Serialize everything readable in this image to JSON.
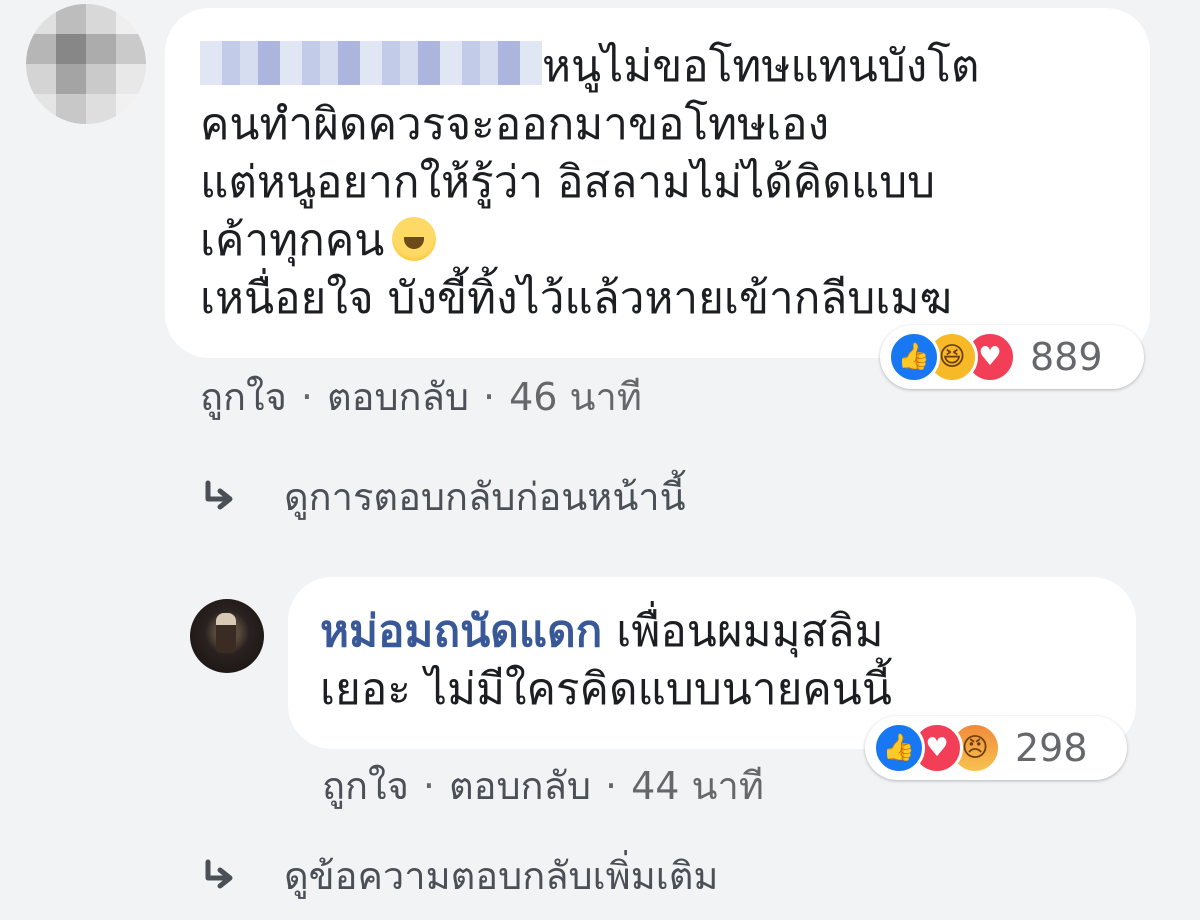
{
  "comment1": {
    "author": "",
    "lines": [
      "หนูไม่ขอโทษแทนบังโต",
      "คนทำผิดควรจะออกมาขอโทษเอง",
      "แต่หนูอยากให้รู้ว่า อิสลามไม่ได้คิดแบบ",
      "เค้าทุกคน",
      "เหนื่อยใจ บังขี้ทิ้งไว้แล้วหายเข้ากลีบเมฆ"
    ],
    "inline_emoji": "crying-face-emoji",
    "reactions": {
      "icons": [
        "like",
        "haha",
        "love"
      ],
      "count": "889"
    },
    "meta": {
      "like": "ถูกใจ",
      "reply": "ตอบกลับ",
      "separator": "·",
      "time": "46 นาที"
    }
  },
  "previous_replies_link": "ดูการตอบกลับก่อนหน้านี้",
  "comment2": {
    "author": "หม่อมถนัดแดก",
    "line1": " เพื่อนผมมุสลิม",
    "line2": "เยอะ ไม่มีใครคิดแบบนายคนนี้",
    "reactions": {
      "icons": [
        "like",
        "love",
        "angry"
      ],
      "count": "298"
    },
    "meta": {
      "like": "ถูกใจ",
      "reply": "ตอบกลับ",
      "separator": "·",
      "time": "44 นาที"
    }
  },
  "more_replies_link": "ดูข้อความตอบกลับเพิ่มเติม",
  "colors": {
    "background": "#f2f3f5",
    "bubble": "#ffffff",
    "author_link": "#385898",
    "meta_text": "#4b4f56",
    "like_blue": "#1877f2",
    "love_red": "#f33e58",
    "haha_yellow": "#f7b928"
  }
}
